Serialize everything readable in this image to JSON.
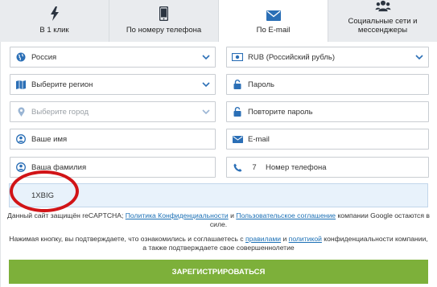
{
  "tabs": [
    {
      "label": "В 1 клик",
      "icon": "lightning-icon"
    },
    {
      "label": "По номеру телефона",
      "icon": "phone-icon"
    },
    {
      "label": "По E-mail",
      "icon": "envelope-icon",
      "active": true
    },
    {
      "label": "Социальные сети и мессенджеры",
      "icon": "users-icon"
    }
  ],
  "form": {
    "country": "Россия",
    "currency": "RUB (Российский рубль)",
    "region_placeholder": "Выберите регион",
    "password_placeholder": "Пароль",
    "city_placeholder": "Выберите город",
    "repeat_password_placeholder": "Повторите пароль",
    "name_placeholder": "Ваше имя",
    "email_placeholder": "E-mail",
    "surname_placeholder": "Ваша фамилия",
    "phone_prefix": "7",
    "phone_placeholder": "Номер телефона",
    "promo_code": "1XBIG"
  },
  "notice": {
    "recaptcha_prefix": "Данный сайт защищён reCAPTCHA;",
    "privacy_link": "Политика Конфиденциальности",
    "and": "и",
    "terms_link": "Пользовательское соглашение",
    "recaptcha_suffix": "компании Google остаются в силе.",
    "consent_prefix": "Нажимая кнопку, вы подтверждаете, что ознакомились и соглашаетесь с",
    "rules_link": "правилами",
    "and2": "и",
    "policy_link": "политикой",
    "consent_middle": "конфиденциальности компании,",
    "consent_line2": "а также подтверждаете свое совершеннолетие"
  },
  "submit_label": "ЗАРЕГИСТРИРОВАТЬСЯ",
  "colors": {
    "accent": "#2b6fb6",
    "button": "#7db03a",
    "annotation": "#d11417"
  }
}
